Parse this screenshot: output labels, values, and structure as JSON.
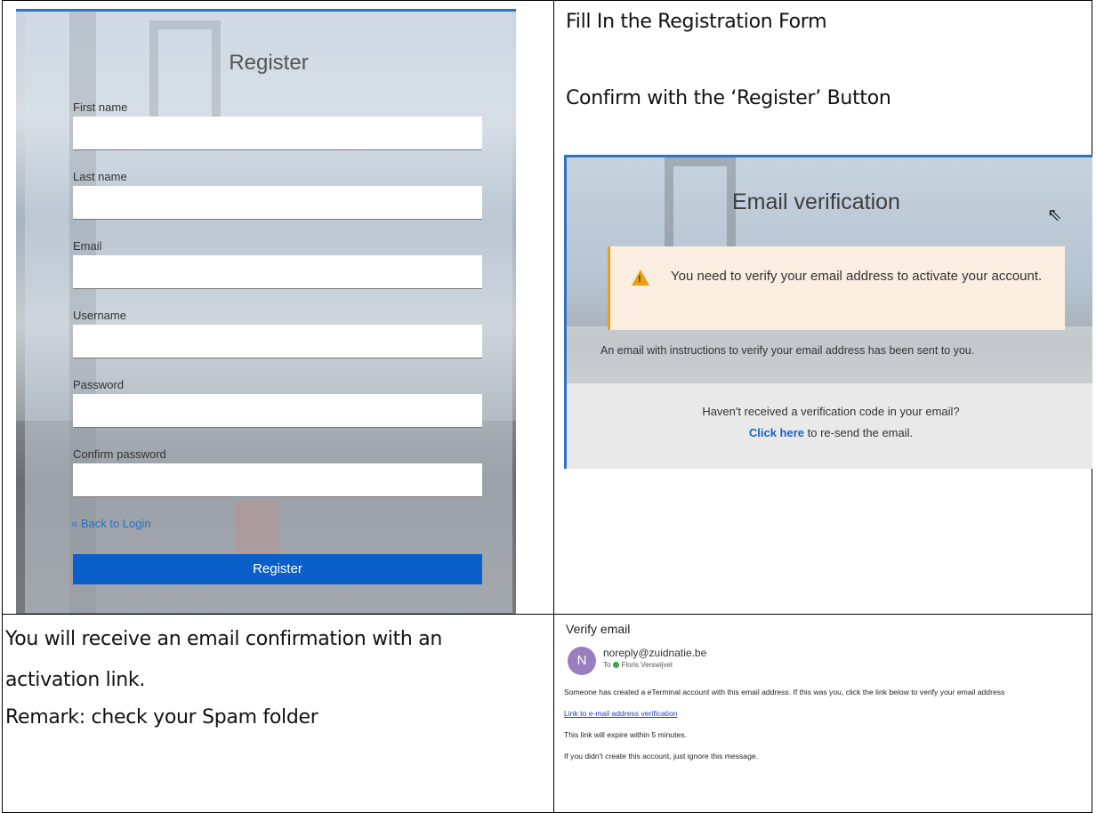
{
  "register_screen": {
    "title": "Register",
    "fields": [
      {
        "label": "First name",
        "value": ""
      },
      {
        "label": "Last name",
        "value": ""
      },
      {
        "label": "Email",
        "value": ""
      },
      {
        "label": "Username",
        "value": ""
      },
      {
        "label": "Password",
        "value": ""
      },
      {
        "label": "Confirm password",
        "value": ""
      }
    ],
    "back_link": "« Back to Login",
    "button_label": "Register"
  },
  "instructions": {
    "top_right_1": "Fill In the Registration Form",
    "top_right_2": "Confirm with the ‘Register’ Button",
    "bottom_left_1": "You will receive an email confirmation with an",
    "bottom_left_2": "activation link.",
    "bottom_left_3": "Remark: check your Spam folder"
  },
  "email_verification_screen": {
    "title": "Email verification",
    "alert_icon": "warning-icon",
    "alert_text": "You need to verify your email address to activate your account.",
    "info_text": "An email with instructions to verify your email address has been sent to you.",
    "footer_question": "Haven't received a verification code in your email?",
    "footer_link": "Click here",
    "footer_suffix": " to re-send the email."
  },
  "email_message": {
    "subject": "Verify email",
    "avatar_letter": "N",
    "from": "noreply@zuidnatie.be",
    "to_label": "To",
    "to_name": "Floris Verswijvel",
    "body_1": "Someone has created a eTerminal account with this email address. If this was you, click the link below to verify your email address",
    "link_text": "Link to e-mail address verification",
    "body_2": "This link will expire within 5 minutes.",
    "body_3": "If you didn't create this account, just ignore this message."
  },
  "colors": {
    "primary_button": "#0a5fc9",
    "link": "#2a6fc4",
    "alert_bg": "#fbeee0",
    "alert_border": "#e8a21c",
    "avatar": "#9a7fc0"
  }
}
